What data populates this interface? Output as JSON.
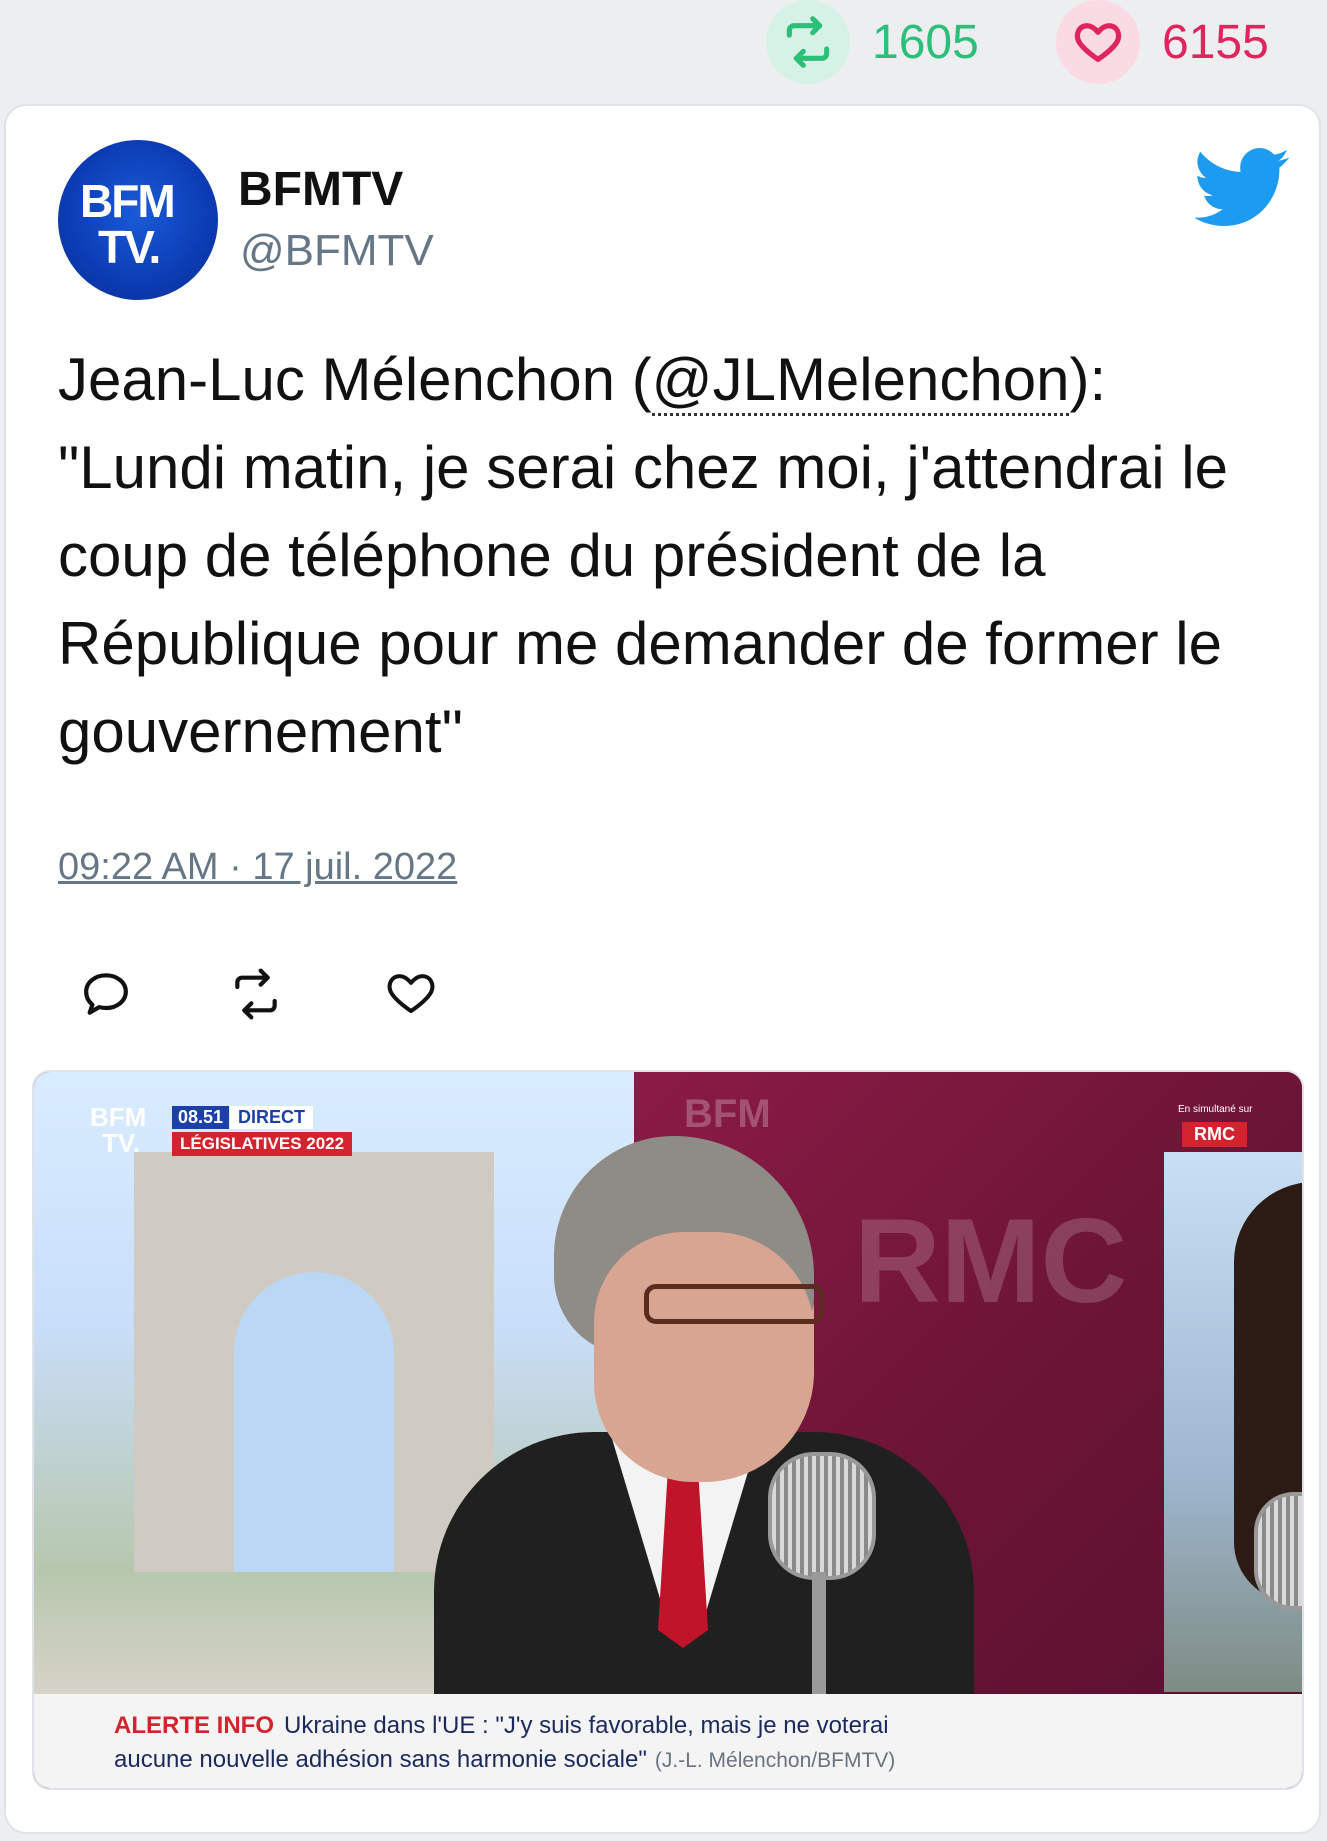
{
  "stats": {
    "retweets": "1605",
    "likes": "6155",
    "retweet_icon": "retweet-icon",
    "like_icon": "heart-icon",
    "retweet_color": "#2cbf7a",
    "like_color": "#e0245e"
  },
  "tweet": {
    "avatar_logo_line1": "BFM",
    "avatar_logo_line2": "TV.",
    "name": "BFMTV",
    "handle": "@BFMTV",
    "text_before_mention": "Jean-Luc Mélenchon (",
    "mention": "@JLMelenchon",
    "text_after_mention": "): \"Lundi matin, je serai chez moi, j'attendrai le coup de téléphone du président de la République pour me demander de former le gouvernement\"",
    "timestamp": "09:22 AM · 17 juil. 2022",
    "accent_color": "#1d9bf0"
  },
  "media": {
    "channel_logo_line1": "BFM",
    "channel_logo_line2": "TV.",
    "time": "08.51",
    "live_label": "DIRECT",
    "program": "LÉGISLATIVES 2022",
    "wall_text": "BFM",
    "wall_rmc": "RMC",
    "rmc_caption": "En simultané sur",
    "rmc_logo": "RMC",
    "alert_label": "ALERTE INFO",
    "ticker_line1": "Ukraine dans l'UE : \"J'y suis favorable, mais je ne voterai",
    "ticker_line2": "aucune nouvelle adhésion sans harmonie sociale\"",
    "ticker_source": "(J.-L. Mélenchon/BFMTV)"
  }
}
